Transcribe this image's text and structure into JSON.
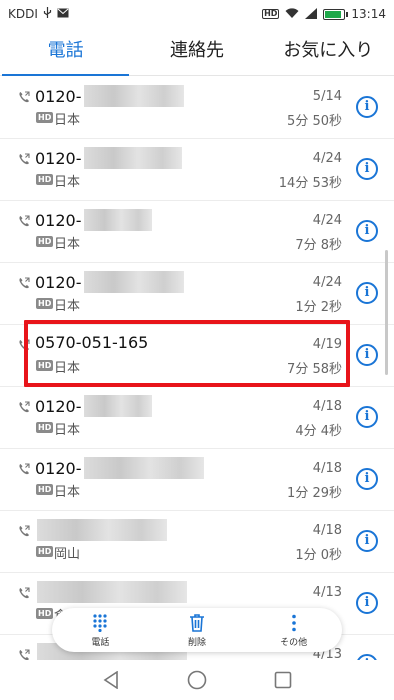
{
  "status_bar": {
    "carrier": "KDDI",
    "time": "13:14",
    "battery_level": 0.85
  },
  "tabs": [
    {
      "label": "電話",
      "active": true
    },
    {
      "label": "連絡先",
      "active": false
    },
    {
      "label": "お気に入り",
      "active": false
    }
  ],
  "calls": [
    {
      "number": "0120-",
      "hd": "HD",
      "location": "日本",
      "date": "5/14",
      "duration": "5分 50秒"
    },
    {
      "number": "0120-",
      "hd": "HD",
      "location": "日本",
      "date": "4/24",
      "duration": "14分 53秒"
    },
    {
      "number": "0120-",
      "hd": "HD",
      "location": "日本",
      "date": "4/24",
      "duration": "7分 8秒"
    },
    {
      "number": "0120-",
      "hd": "HD",
      "location": "日本",
      "date": "4/24",
      "duration": "1分 2秒"
    },
    {
      "number": "0570-051-165",
      "hd": "HD",
      "location": "日本",
      "date": "4/19",
      "duration": "7分 58秒"
    },
    {
      "number": "0120-",
      "hd": "HD",
      "location": "日本",
      "date": "4/18",
      "duration": "4分 4秒"
    },
    {
      "number": "0120-",
      "hd": "HD",
      "location": "日本",
      "date": "4/18",
      "duration": "1分 29秒"
    },
    {
      "number": "",
      "hd": "HD",
      "location": "岡山",
      "date": "4/18",
      "duration": "1分 0秒"
    },
    {
      "number": "",
      "hd": "HD",
      "location": "倉敷",
      "date": "4/13",
      "duration": ""
    },
    {
      "number": "",
      "hd": "HD",
      "location": "",
      "date": "4/13",
      "duration": ""
    }
  ],
  "info_glyph": "i",
  "actions": [
    {
      "label": "電話",
      "icon": "dialpad-icon"
    },
    {
      "label": "削除",
      "icon": "trash-icon"
    },
    {
      "label": "その他",
      "icon": "more-vertical-icon"
    }
  ],
  "colors": {
    "accent": "#1a75d6",
    "highlight": "#e8141a"
  }
}
